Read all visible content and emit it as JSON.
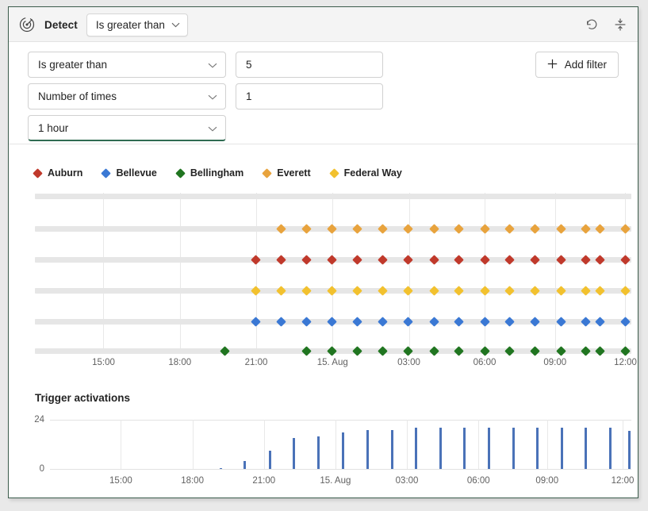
{
  "header": {
    "icon": "detect-radar-icon",
    "title": "Detect",
    "condition_select": {
      "value": "Is greater than",
      "chevron": "chevron-down-icon"
    },
    "reset_icon": "reset-undo-icon",
    "collapse_icon": "collapse-vertical-icon"
  },
  "filters": {
    "rows": [
      {
        "select": "Is greater than",
        "value": "5",
        "has_value": true,
        "focused": false
      },
      {
        "select": "Number of times",
        "value": "1",
        "has_value": true,
        "focused": false
      },
      {
        "select": "1 hour",
        "value": "",
        "has_value": false,
        "focused": true
      }
    ],
    "add_filter": {
      "label": "Add filter",
      "icon": "plus-icon"
    }
  },
  "chart_data": [
    {
      "type": "scatter",
      "title": "",
      "xlabel": "",
      "ylabel": "",
      "grid": true,
      "legend_position": "top-left",
      "x_ticks": [
        "15:00",
        "18:00",
        "21:00",
        "15. Aug",
        "03:00",
        "06:00",
        "09:00",
        "12:00"
      ],
      "x_tick_positions": [
        0.115,
        0.243,
        0.371,
        0.499,
        0.627,
        0.754,
        0.872,
        0.99
      ],
      "xlim_labels": [
        "14:00",
        "12:30"
      ],
      "rows": [
        {
          "name": "(empty)",
          "color": "#e6e6e6",
          "y": 0.02,
          "points": []
        },
        {
          "name": "Everett",
          "color": "#e8a33d",
          "y": 0.225,
          "points": [
            0.413,
            0.456,
            0.498,
            0.541,
            0.583,
            0.626,
            0.669,
            0.711,
            0.754,
            0.796,
            0.839,
            0.882,
            0.924,
            0.947,
            0.99
          ]
        },
        {
          "name": "Auburn",
          "color": "#c0392b",
          "y": 0.42,
          "points": [
            0.371,
            0.413,
            0.456,
            0.498,
            0.541,
            0.583,
            0.626,
            0.669,
            0.711,
            0.754,
            0.796,
            0.839,
            0.882,
            0.924,
            0.947,
            0.99
          ]
        },
        {
          "name": "Federal Way",
          "color": "#f2c12e",
          "y": 0.615,
          "points": [
            0.371,
            0.413,
            0.456,
            0.498,
            0.541,
            0.583,
            0.626,
            0.669,
            0.711,
            0.754,
            0.796,
            0.839,
            0.882,
            0.924,
            0.947,
            0.99
          ]
        },
        {
          "name": "Bellevue",
          "color": "#3a78d4",
          "y": 0.81,
          "points": [
            0.371,
            0.413,
            0.456,
            0.498,
            0.541,
            0.583,
            0.626,
            0.669,
            0.711,
            0.754,
            0.796,
            0.839,
            0.882,
            0.924,
            0.947,
            0.99
          ]
        },
        {
          "name": "Bellingham",
          "color": "#207520",
          "y": 0.995,
          "points": [
            0.318,
            0.456,
            0.498,
            0.541,
            0.583,
            0.626,
            0.669,
            0.711,
            0.754,
            0.796,
            0.839,
            0.882,
            0.924,
            0.947,
            0.99
          ]
        }
      ],
      "legend": [
        {
          "label": "Auburn",
          "color": "#c0392b"
        },
        {
          "label": "Bellevue",
          "color": "#3a78d4"
        },
        {
          "label": "Bellingham",
          "color": "#207520"
        },
        {
          "label": "Everett",
          "color": "#e8a33d"
        },
        {
          "label": "Federal Way",
          "color": "#f2c12e"
        }
      ]
    },
    {
      "type": "bar",
      "title": "Trigger activations",
      "xlabel": "",
      "ylabel": "",
      "ylim": [
        0,
        24
      ],
      "y_ticks": [
        "0",
        "24"
      ],
      "grid": true,
      "bar_color": "#4a72b8",
      "x_ticks": [
        "15:00",
        "18:00",
        "21:00",
        "15. Aug",
        "03:00",
        "06:00",
        "09:00",
        "12:00"
      ],
      "x_tick_positions": [
        0.122,
        0.245,
        0.368,
        0.491,
        0.614,
        0.737,
        0.855,
        0.985
      ],
      "x": [
        0.294,
        0.335,
        0.378,
        0.42,
        0.462,
        0.504,
        0.546,
        0.588,
        0.63,
        0.672,
        0.713,
        0.755,
        0.797,
        0.839,
        0.88,
        0.922,
        0.964,
        0.996
      ],
      "values": [
        0.3,
        4,
        9,
        15,
        16,
        18,
        19,
        19,
        20,
        20,
        20,
        20,
        20,
        20,
        20,
        20,
        20,
        18.5
      ]
    }
  ]
}
